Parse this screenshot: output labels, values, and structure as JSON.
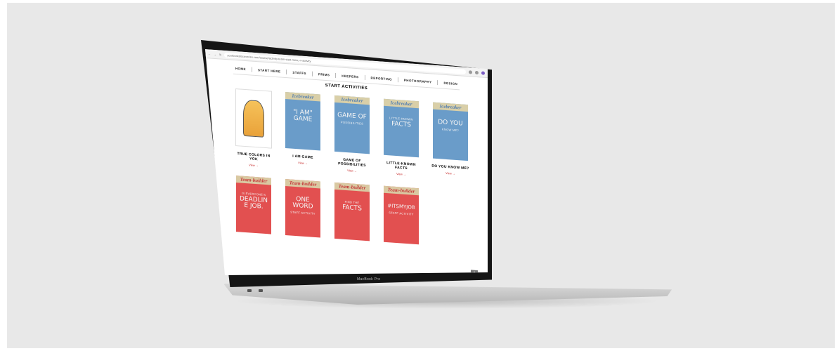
{
  "device": {
    "model_label": "MacBook Pro"
  },
  "browser": {
    "url": "yourbookdiscoveries.com/course/activity-team-start-menu-v-activity"
  },
  "nav": {
    "items": [
      "HOME",
      "START HERE",
      "STAFFS",
      "PRIMS",
      "KEEPERS",
      "REPORTING",
      "PHOTOGRAPHY",
      "DESIGN"
    ]
  },
  "page": {
    "section_title": "START ACTIVITIES"
  },
  "cards_row1": [
    {
      "banner": "",
      "poster_text": "",
      "poster_sub": "",
      "title": "TRUE COLORS IN YOK",
      "link": "View →",
      "style": "cartoon"
    },
    {
      "banner": "Icebreaker",
      "poster_text": "\"I AM\" GAME",
      "poster_sub": "",
      "title": "I AM GAME",
      "link": "View →",
      "style": "ice"
    },
    {
      "banner": "Icebreaker",
      "poster_text": "GAME OF",
      "poster_sub": "POSSIBILITIES",
      "title": "GAME OF POSSIBILITIES",
      "link": "View →",
      "style": "ice"
    },
    {
      "banner": "Icebreaker",
      "poster_text": "FACTS",
      "poster_sub": "LITTLE-KNOWN",
      "title": "LITTLE-KNOWN FACTS",
      "link": "View →",
      "style": "ice"
    },
    {
      "banner": "Icebreaker",
      "poster_text": "DO YOU",
      "poster_sub": "KNOW ME?",
      "title": "DO YOU KNOW ME?",
      "link": "View →",
      "style": "ice"
    }
  ],
  "cards_row2": [
    {
      "banner": "Team-builder",
      "poster_text": "DEADLINE JOB.",
      "poster_sub": "IS EVERYONE'S",
      "style": "team"
    },
    {
      "banner": "Team-builder",
      "poster_text": "ONE WORD",
      "poster_sub": "STAFF ACTIVITY",
      "style": "team"
    },
    {
      "banner": "Team-builder",
      "poster_text": "FACTS",
      "poster_sub": "FIND THE",
      "style": "team"
    },
    {
      "banner": "Team-builder",
      "poster_text": "#ITSMYJOB",
      "poster_sub": "STAFF ACTIVITY",
      "style": "team"
    }
  ],
  "scroll_button": {
    "label": "^"
  },
  "colors": {
    "icebreaker": "#6a9cc9",
    "teambuilder": "#e25050",
    "link": "#c62828",
    "backdrop": "#e8e8e8"
  }
}
